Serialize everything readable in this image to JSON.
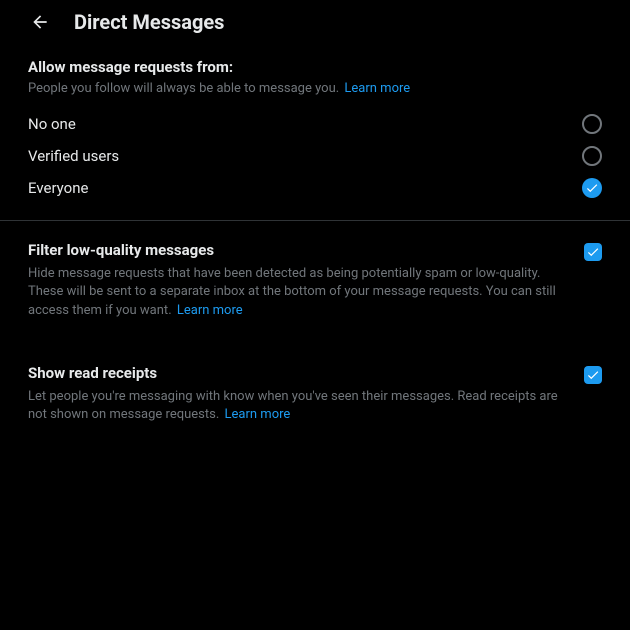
{
  "header": {
    "title": "Direct Messages"
  },
  "allow": {
    "title": "Allow message requests from:",
    "desc": "People you follow will always be able to message you.",
    "learn": "Learn more",
    "options": {
      "no_one": "No one",
      "verified": "Verified users",
      "everyone": "Everyone"
    },
    "selected": "everyone"
  },
  "filter": {
    "title": "Filter low-quality messages",
    "desc": "Hide message requests that have been detected as being potentially spam or low-quality. These will be sent to a separate inbox at the bottom of your message requests. You can still access them if you want.",
    "learn": "Learn more",
    "checked": true
  },
  "receipts": {
    "title": "Show read receipts",
    "desc": "Let people you're messaging with know when you've seen their messages. Read receipts are not shown on message requests.",
    "learn": "Learn more",
    "checked": true
  }
}
